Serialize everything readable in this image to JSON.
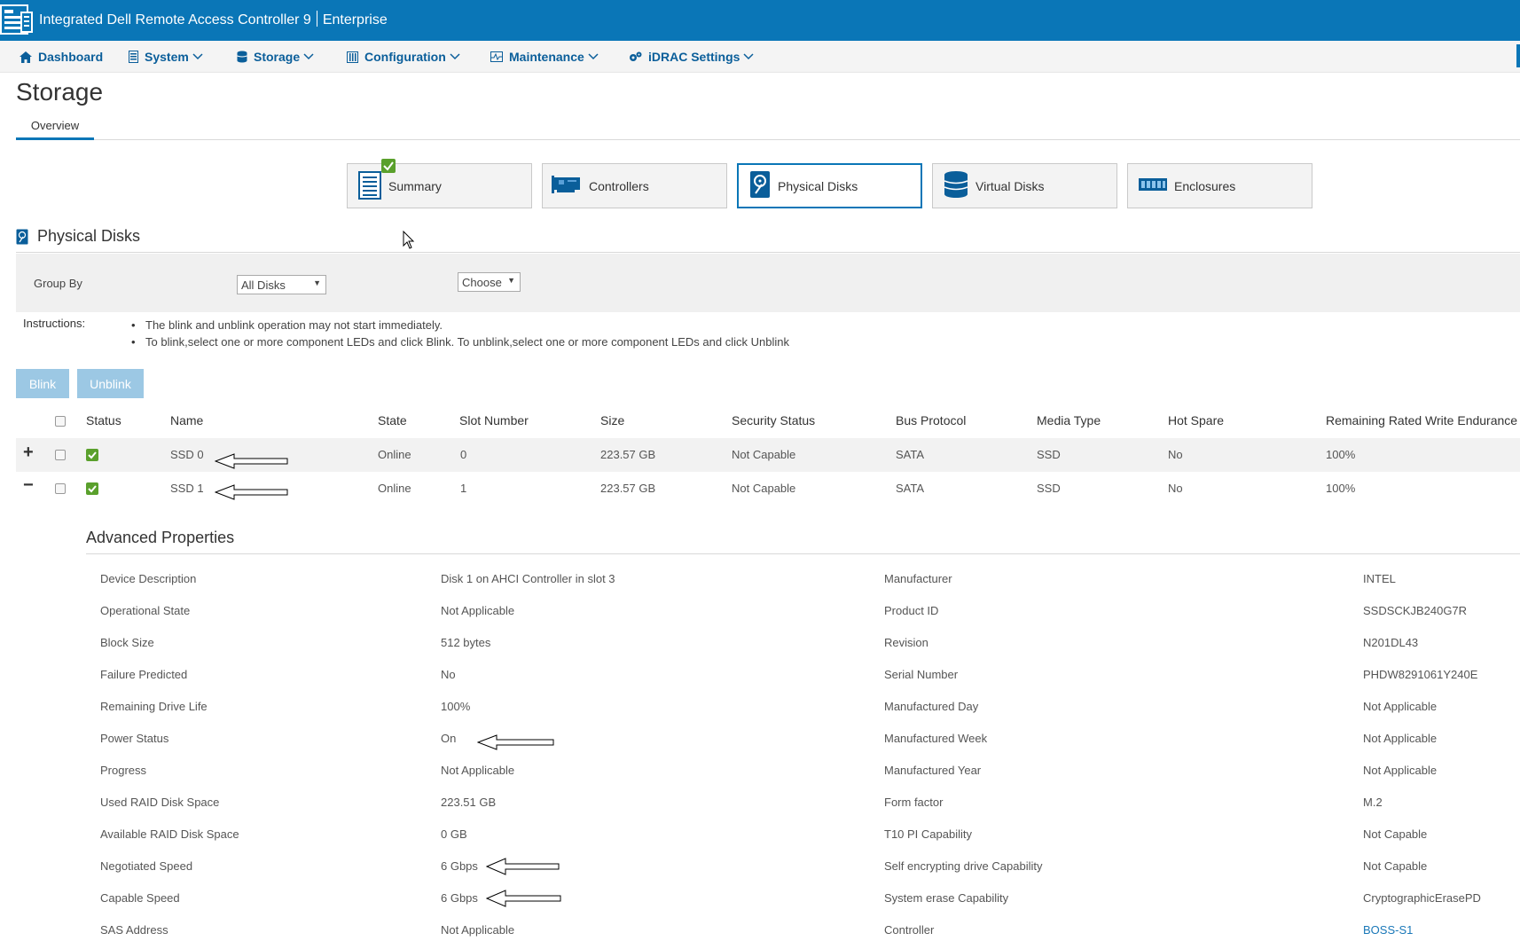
{
  "app": {
    "title": "Integrated Dell Remote Access Controller 9",
    "edition": "Enterprise"
  },
  "nav": [
    {
      "label": "Dashboard",
      "icon": "home-icon",
      "dropdown": false
    },
    {
      "label": "System",
      "icon": "server-icon",
      "dropdown": true
    },
    {
      "label": "Storage",
      "icon": "database-icon",
      "dropdown": true
    },
    {
      "label": "Configuration",
      "icon": "sliders-icon",
      "dropdown": true
    },
    {
      "label": "Maintenance",
      "icon": "pulse-icon",
      "dropdown": true
    },
    {
      "label": "iDRAC Settings",
      "icon": "gears-icon",
      "dropdown": true
    }
  ],
  "page": {
    "title": "Storage",
    "tabs": [
      {
        "label": "Overview",
        "active": true
      }
    ]
  },
  "tiles": [
    {
      "label": "Summary",
      "icon": "summary-icon",
      "active": false
    },
    {
      "label": "Controllers",
      "icon": "controller-card-icon",
      "active": false
    },
    {
      "label": "Physical Disks",
      "icon": "physical-disk-icon",
      "active": true
    },
    {
      "label": "Virtual Disks",
      "icon": "virtual-disk-icon",
      "active": false
    },
    {
      "label": "Enclosures",
      "icon": "enclosure-icon",
      "active": false
    }
  ],
  "section": {
    "title": "Physical Disks",
    "group_by_label": "Group By",
    "group_by_value": "All Disks",
    "choose_value": "Choose"
  },
  "instructions": {
    "label": "Instructions:",
    "items": [
      "The blink and unblink operation may not start immediately.",
      "To blink,select one or more component LEDs and click Blink. To unblink,select one or more component LEDs and click Unblink"
    ]
  },
  "actions": {
    "blink": "Blink",
    "unblink": "Unblink"
  },
  "table": {
    "headers": [
      "Status",
      "Name",
      "State",
      "Slot Number",
      "Size",
      "Security Status",
      "Bus Protocol",
      "Media Type",
      "Hot Spare",
      "Remaining Rated Write Endurance"
    ],
    "rows": [
      {
        "expander": "+",
        "name": "SSD 0",
        "state": "Online",
        "slot": "0",
        "size": "223.57 GB",
        "security": "Not Capable",
        "bus": "SATA",
        "media": "SSD",
        "hot_spare": "No",
        "endurance": "100%"
      },
      {
        "expander": "−",
        "name": "SSD 1",
        "state": "Online",
        "slot": "1",
        "size": "223.57 GB",
        "security": "Not Capable",
        "bus": "SATA",
        "media": "SSD",
        "hot_spare": "No",
        "endurance": "100%"
      }
    ]
  },
  "advanced": {
    "title": "Advanced Properties",
    "left": [
      {
        "label": "Device Description",
        "value": "Disk 1 on AHCI Controller in slot 3"
      },
      {
        "label": "Operational State",
        "value": "Not Applicable"
      },
      {
        "label": "Block Size",
        "value": "512 bytes"
      },
      {
        "label": "Failure Predicted",
        "value": "No"
      },
      {
        "label": "Remaining Drive Life",
        "value": "100%"
      },
      {
        "label": "Power Status",
        "value": "On"
      },
      {
        "label": "Progress",
        "value": "Not Applicable"
      },
      {
        "label": "Used RAID Disk Space",
        "value": "223.51 GB"
      },
      {
        "label": "Available RAID Disk Space",
        "value": "0 GB"
      },
      {
        "label": "Negotiated Speed",
        "value": "6 Gbps"
      },
      {
        "label": "Capable Speed",
        "value": "6 Gbps"
      },
      {
        "label": "SAS Address",
        "value": "Not Applicable"
      }
    ],
    "right": [
      {
        "label": "Manufacturer",
        "value": "INTEL"
      },
      {
        "label": "Product ID",
        "value": "SSDSCKJB240G7R"
      },
      {
        "label": "Revision",
        "value": "N201DL43"
      },
      {
        "label": "Serial Number",
        "value": "PHDW8291061Y240E"
      },
      {
        "label": "Manufactured Day",
        "value": "Not Applicable"
      },
      {
        "label": "Manufactured Week",
        "value": "Not Applicable"
      },
      {
        "label": "Manufactured Year",
        "value": "Not Applicable"
      },
      {
        "label": "Form factor",
        "value": "M.2"
      },
      {
        "label": "T10 PI Capability",
        "value": "Not Capable"
      },
      {
        "label": "Self encrypting drive Capability",
        "value": "Not Capable"
      },
      {
        "label": "System erase Capability",
        "value": "CryptographicErasePD"
      },
      {
        "label": "Controller",
        "value": "BOSS-S1"
      }
    ]
  },
  "colors": {
    "header_blue": "#0a76b7",
    "nav_text": "#0a5e9a",
    "status_green": "#5aa02c",
    "disabled_button": "#9cc8e4",
    "link": "#1a78b8"
  }
}
